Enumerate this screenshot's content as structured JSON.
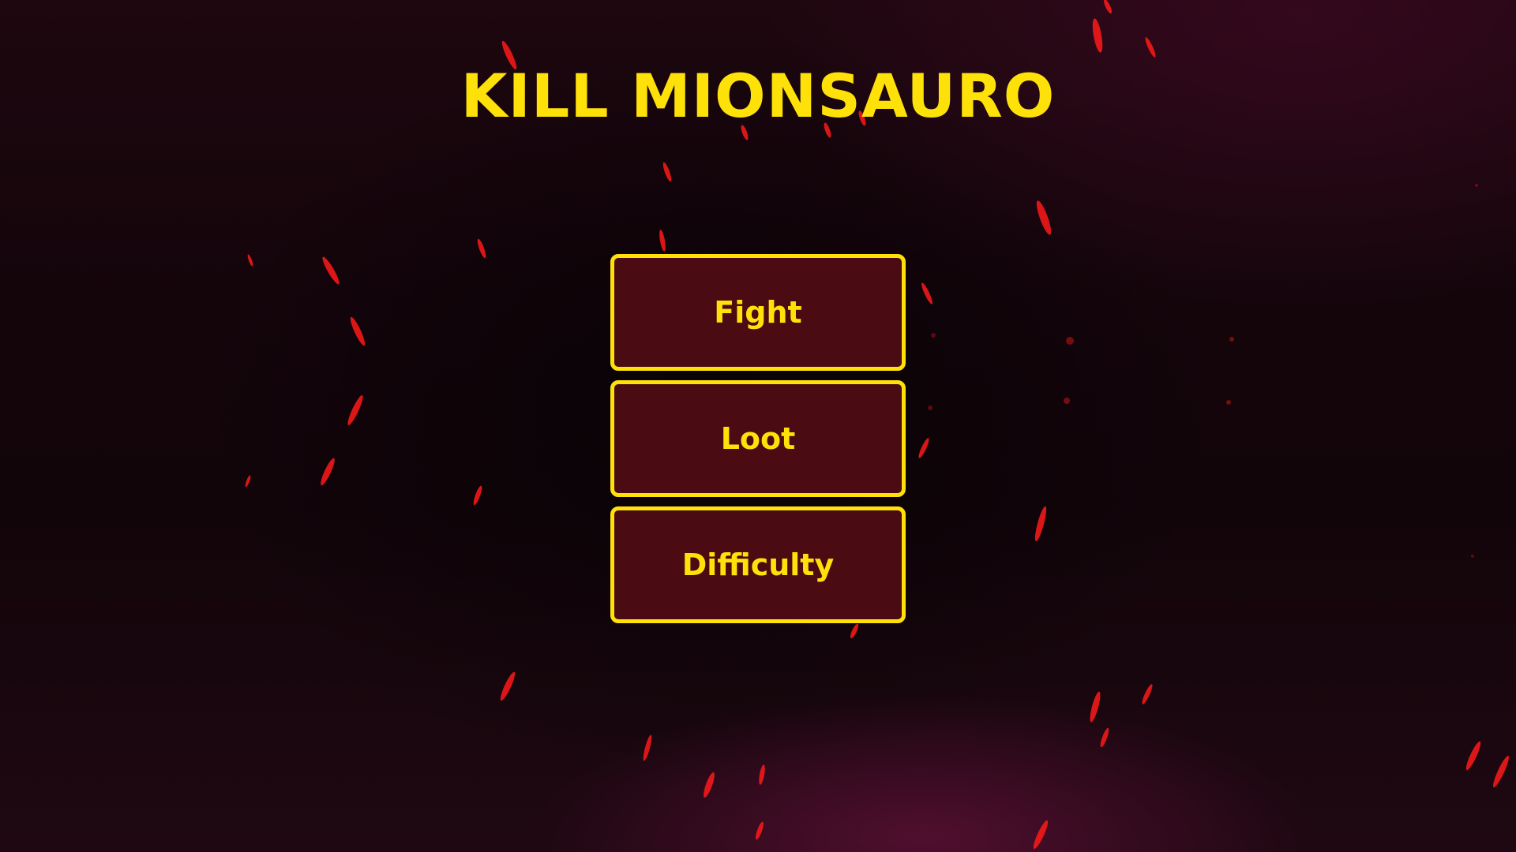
{
  "game": {
    "title": "KILL MIONSAURO"
  },
  "menu": {
    "items": [
      {
        "label": "Fight"
      },
      {
        "label": "Loot"
      },
      {
        "label": "Difficulty"
      }
    ]
  },
  "theme": {
    "accent": "#ffe10a",
    "button_bg": "#4a0b12",
    "spark_color": "#ff1a1a",
    "background": "#14050b"
  },
  "background": {
    "effect": "falling red ember sparks"
  }
}
